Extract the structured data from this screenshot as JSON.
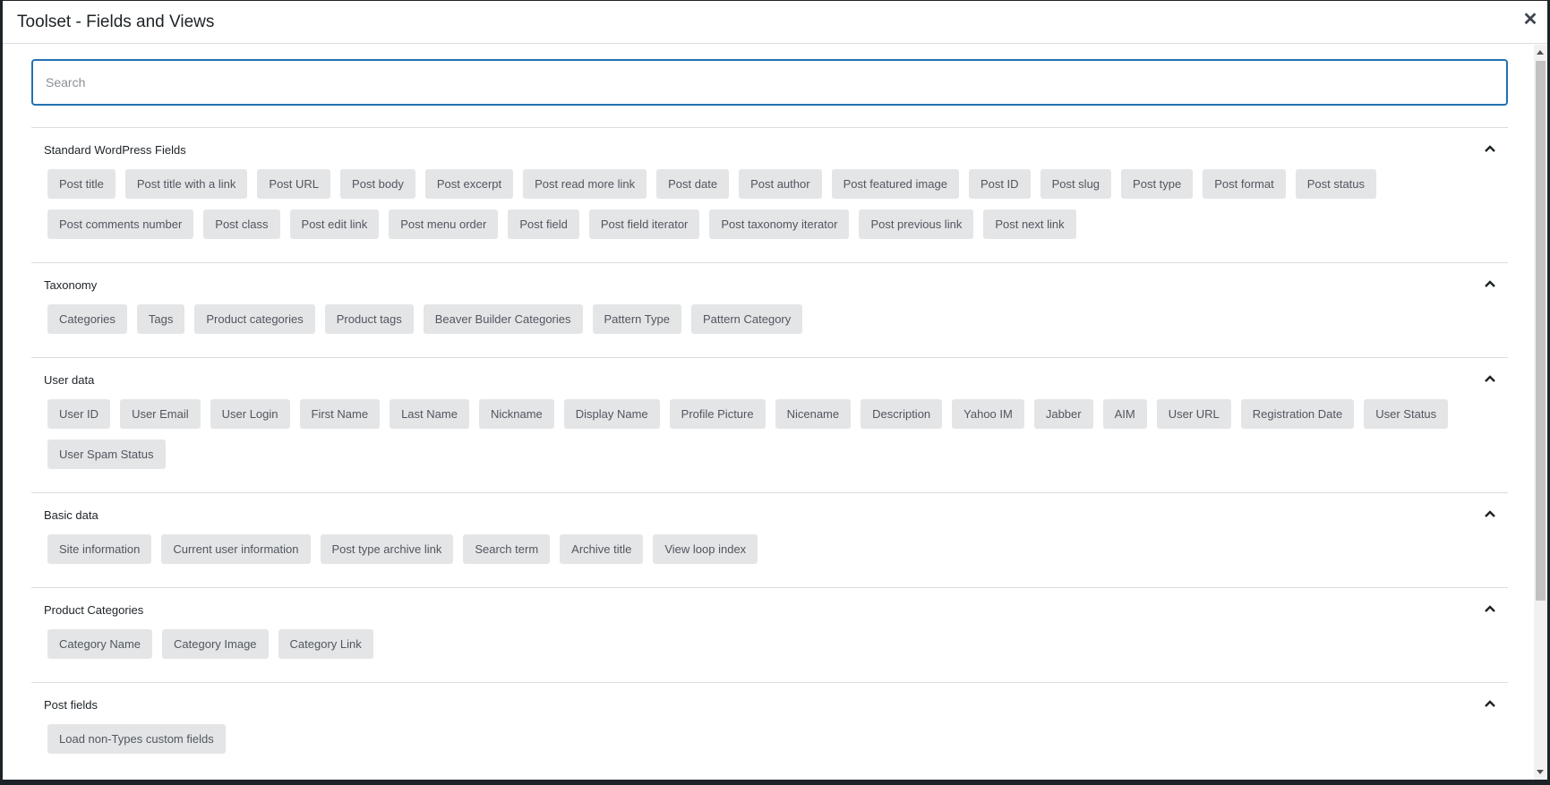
{
  "modal": {
    "title": "Toolset - Fields and Views",
    "close_icon": "close-icon"
  },
  "search": {
    "placeholder": "Search",
    "value": ""
  },
  "sections": [
    {
      "title": "Standard WordPress Fields",
      "chips": [
        "Post title",
        "Post title with a link",
        "Post URL",
        "Post body",
        "Post excerpt",
        "Post read more link",
        "Post date",
        "Post author",
        "Post featured image",
        "Post ID",
        "Post slug",
        "Post type",
        "Post format",
        "Post status",
        "Post comments number",
        "Post class",
        "Post edit link",
        "Post menu order",
        "Post field",
        "Post field iterator",
        "Post taxonomy iterator",
        "Post previous link",
        "Post next link"
      ]
    },
    {
      "title": "Taxonomy",
      "chips": [
        "Categories",
        "Tags",
        "Product categories",
        "Product tags",
        "Beaver Builder Categories",
        "Pattern Type",
        "Pattern Category"
      ]
    },
    {
      "title": "User data",
      "chips": [
        "User ID",
        "User Email",
        "User Login",
        "First Name",
        "Last Name",
        "Nickname",
        "Display Name",
        "Profile Picture",
        "Nicename",
        "Description",
        "Yahoo IM",
        "Jabber",
        "AIM",
        "User URL",
        "Registration Date",
        "User Status",
        "User Spam Status"
      ]
    },
    {
      "title": "Basic data",
      "chips": [
        "Site information",
        "Current user information",
        "Post type archive link",
        "Search term",
        "Archive title",
        "View loop index"
      ]
    },
    {
      "title": "Product Categories",
      "chips": [
        "Category Name",
        "Category Image",
        "Category Link"
      ]
    },
    {
      "title": "Post fields",
      "chips": [
        "Load non-Types custom fields"
      ]
    }
  ],
  "colors": {
    "accent": "#2271b1",
    "chip_bg": "#e4e5e7",
    "chip_text": "#50575e"
  }
}
